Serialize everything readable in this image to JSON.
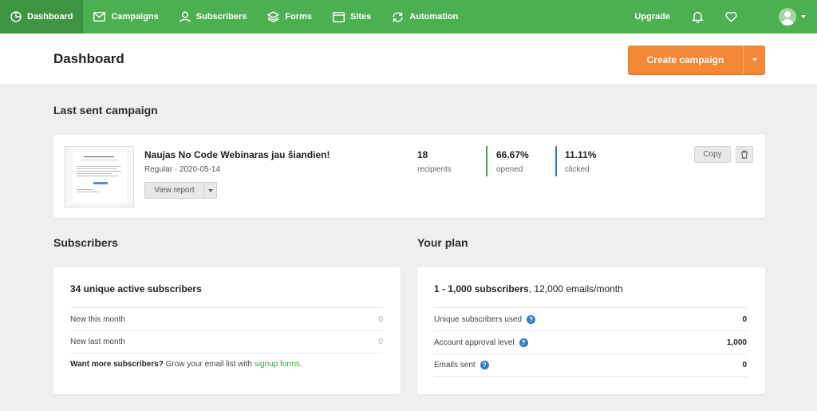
{
  "nav": {
    "items": [
      {
        "label": "Dashboard",
        "icon": "dashboard-icon"
      },
      {
        "label": "Campaigns",
        "icon": "mail-icon"
      },
      {
        "label": "Subscribers",
        "icon": "user-icon"
      },
      {
        "label": "Forms",
        "icon": "layers-icon"
      },
      {
        "label": "Sites",
        "icon": "browser-icon"
      },
      {
        "label": "Automation",
        "icon": "sync-icon"
      }
    ],
    "upgrade": "Upgrade"
  },
  "header": {
    "title": "Dashboard",
    "create_button": "Create campaign"
  },
  "last_campaign": {
    "section_title": "Last sent campaign",
    "name": "Naujas No Code Webinaras jau šiandien!",
    "meta": "Regular · 2020-05-14",
    "view_report": "View report",
    "stats": [
      {
        "value": "18",
        "label": "recipients"
      },
      {
        "value": "66.67%",
        "label": "opened"
      },
      {
        "value": "11.11%",
        "label": "clicked"
      }
    ],
    "copy": "Copy"
  },
  "subscribers": {
    "section_title": "Subscribers",
    "heading": "34 unique active subscribers",
    "rows": [
      {
        "label": "New this month",
        "value": "0"
      },
      {
        "label": "New last month",
        "value": "0"
      }
    ],
    "footer_bold": "Want more subscribers?",
    "footer_text": " Grow your email list with ",
    "footer_link": "signup forms",
    "footer_end": "."
  },
  "plan": {
    "section_title": "Your plan",
    "heading_bold": "1 - 1,000 subscribers",
    "heading_rest": ", 12,000 emails/month",
    "rows": [
      {
        "label": "Unique subscribers used",
        "value": "0"
      },
      {
        "label": "Account approval level",
        "value": "1,000"
      },
      {
        "label": "Emails sent",
        "value": "0"
      }
    ],
    "help_mark": "?"
  },
  "colors": {
    "nav_green": "#4caf50",
    "accent_orange": "#f38735",
    "opened_bar": "#3aa541",
    "clicked_bar": "#2f7fc1",
    "link_green": "#3aa541"
  }
}
